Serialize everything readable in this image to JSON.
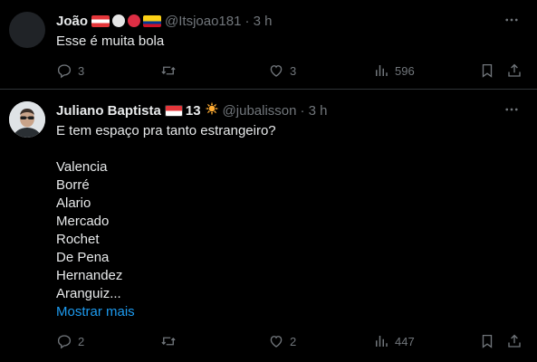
{
  "tweets": [
    {
      "name": "João",
      "handle": "@Itsjoao181",
      "time": "· 3 h",
      "lines": [
        "Esse é muita bola"
      ],
      "replies": "3",
      "retweets": "",
      "likes": "3",
      "views": "596"
    },
    {
      "name": "Juliano Baptista",
      "badge_text": "13",
      "handle": "@jubalisson",
      "time": "· 3 h",
      "lines": [
        "E tem espaço pra tanto estrangeiro?",
        "",
        "Valencia",
        "Borré",
        "Alario",
        "Mercado",
        "Rochet",
        "De Pena",
        "Hernandez",
        "Aranguiz..."
      ],
      "show_more": "Mostrar mais",
      "replies": "2",
      "retweets": "",
      "likes": "2",
      "views": "447"
    }
  ],
  "colors": {
    "background": "#000000",
    "text": "#e7e9ea",
    "muted": "#71767b",
    "link": "#1d9bf0",
    "divider": "#2f3336"
  },
  "icons": {
    "reply": "speech-bubble-icon",
    "retweet": "retweet-arrows-icon",
    "like": "heart-icon",
    "views": "bar-chart-icon",
    "bookmark": "bookmark-icon",
    "share": "share-upload-icon",
    "more": "ellipsis-icon"
  }
}
